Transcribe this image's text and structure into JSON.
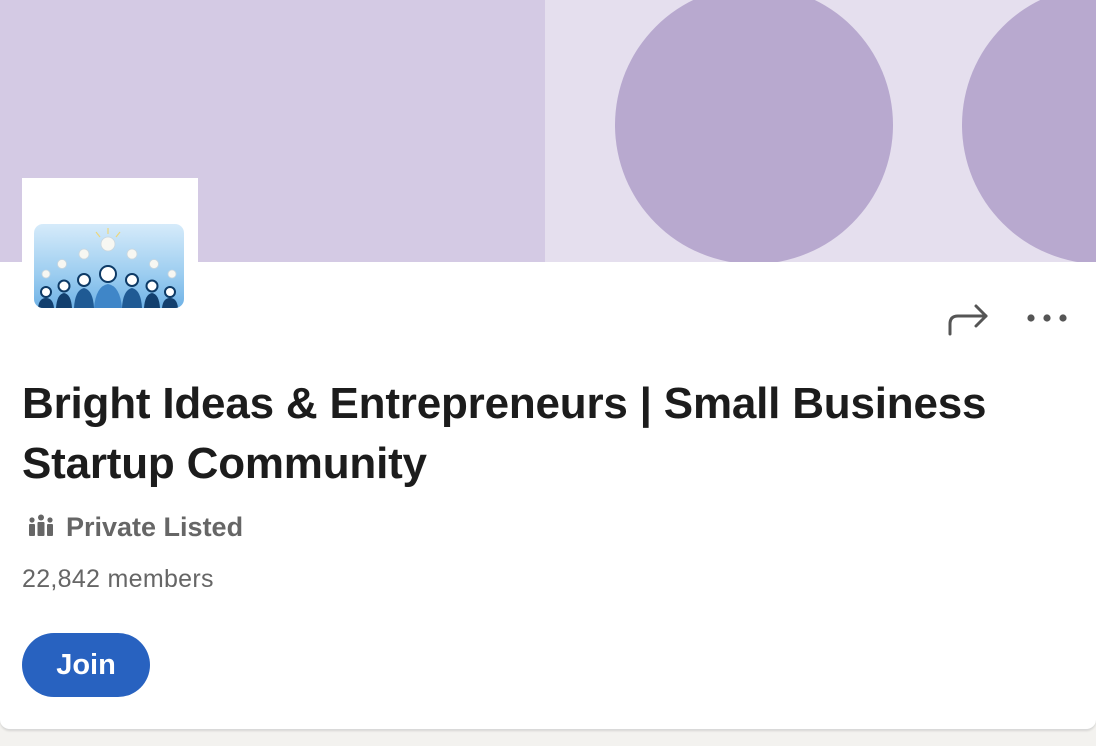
{
  "group": {
    "title": "Bright Ideas & Entrepreneurs | Small Business Startup Community",
    "privacy": "Private Listed",
    "members": "22,842 members",
    "join_label": "Join",
    "logo_icon": "lightbulb-people-icon",
    "privacy_icon": "people-group-icon"
  },
  "actions": {
    "share_icon": "share-arrow-icon",
    "more_icon": "more-horizontal-icon"
  },
  "colors": {
    "accent": "#2862c0",
    "cover_left": "#d4cae4",
    "cover_right": "#e5dfee",
    "cover_circles": "#b8a9cf",
    "title_text": "#1c1c1c",
    "secondary_text": "#666666"
  }
}
